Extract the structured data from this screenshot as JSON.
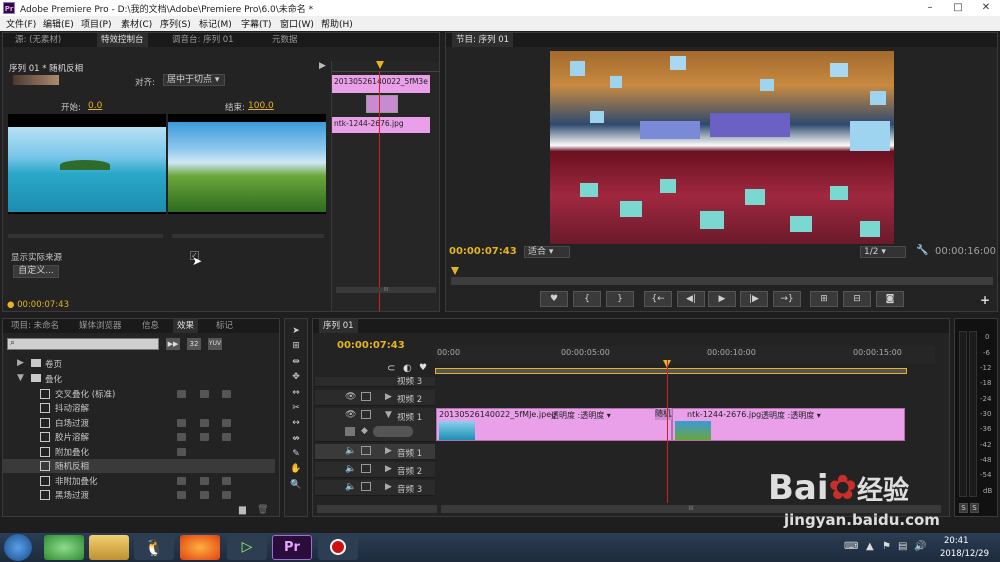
{
  "window": {
    "app_badge": "Pr",
    "title": "Adobe Premiere Pro - D:\\我的文档\\Adobe\\Premiere Pro\\6.0\\未命名 *"
  },
  "menu": [
    "文件(F)",
    "编辑(E)",
    "项目(P)",
    "素材(C)",
    "序列(S)",
    "标记(M)",
    "字幕(T)",
    "窗口(W)",
    "帮助(H)"
  ],
  "source_panel": {
    "tabs": [
      "源: (无素材)",
      "特效控制台",
      "调音台: 序列 01",
      "元数据"
    ],
    "sequence_label": "序列 01 * 随机反相",
    "align_label": "对齐:",
    "align_value": "居中于切点",
    "start_label": "开始:",
    "start_value": "0.0",
    "end_label": "结束:",
    "end_value": "100.0",
    "show_source": "显示实际来源",
    "custom_button": "自定义...",
    "timecode": "00:00:07:43",
    "mini_clip_a": "20130526140022_5fM3e",
    "mini_clip_b": "ntk-1244-2676.jpg",
    "scroll_grip": "III"
  },
  "program_panel": {
    "tab": "节目: 序列 01",
    "timecode": "00:00:07:43",
    "fit_label": "适合",
    "quality": "1/2",
    "duration": "00:00:16:00",
    "transport": [
      "♥",
      "{",
      "}",
      "{←",
      "◀|",
      "▶",
      "|▶",
      "→}",
      "⊞",
      "⊟",
      "◙"
    ]
  },
  "project_panel": {
    "tabs": [
      "项目: 未命名",
      "媒体浏览器",
      "信息",
      "效果",
      "标记"
    ],
    "badges": [
      "32",
      "YUV"
    ],
    "folders": [
      {
        "name": "卷页"
      },
      {
        "name": "叠化"
      }
    ],
    "effects": [
      "交叉叠化 (标准)",
      "抖动溶解",
      "白场过渡",
      "胶片溶解",
      "附加叠化",
      "随机反相",
      "非附加叠化",
      "黑场过渡"
    ]
  },
  "timeline": {
    "tab": "序列 01",
    "timecode": "00:00:07:43",
    "ruler": [
      "00:00",
      "00:00:05:00",
      "00:00:10:00",
      "00:00:15:00"
    ],
    "tracks": [
      {
        "name": "视频 3"
      },
      {
        "name": "视频 2"
      },
      {
        "name": "视频 1"
      },
      {
        "name": "音频 1"
      },
      {
        "name": "音频 2"
      },
      {
        "name": "音频 3"
      }
    ],
    "clip_a": "20130526140022_5fMJe.jpeg",
    "clip_a_fx": "透明度 :透明度 ▾",
    "transition": "随机反",
    "clip_b": "ntk-1244-2676.jpg",
    "clip_b_fx": "透明度 :透明度 ▾",
    "scroll_grip": "III"
  },
  "audio_meter": {
    "labels": [
      "0",
      "-6",
      "-12",
      "-18",
      "-24",
      "-30",
      "-36",
      "-42",
      "-48",
      "-54",
      "dB"
    ],
    "solo": [
      "S",
      "S"
    ]
  },
  "taskbar": {
    "time": "20:41",
    "date": "2018/12/29",
    "pr_label": "Pr"
  },
  "watermark": {
    "brand": "Bai",
    "brand_suffix": "经验",
    "url": "jingyan.baidu.com"
  },
  "colors": {
    "accent_yellow": "#e6b422",
    "clip_pink": "#e9a0e8",
    "playhead_red": "#d02020"
  }
}
